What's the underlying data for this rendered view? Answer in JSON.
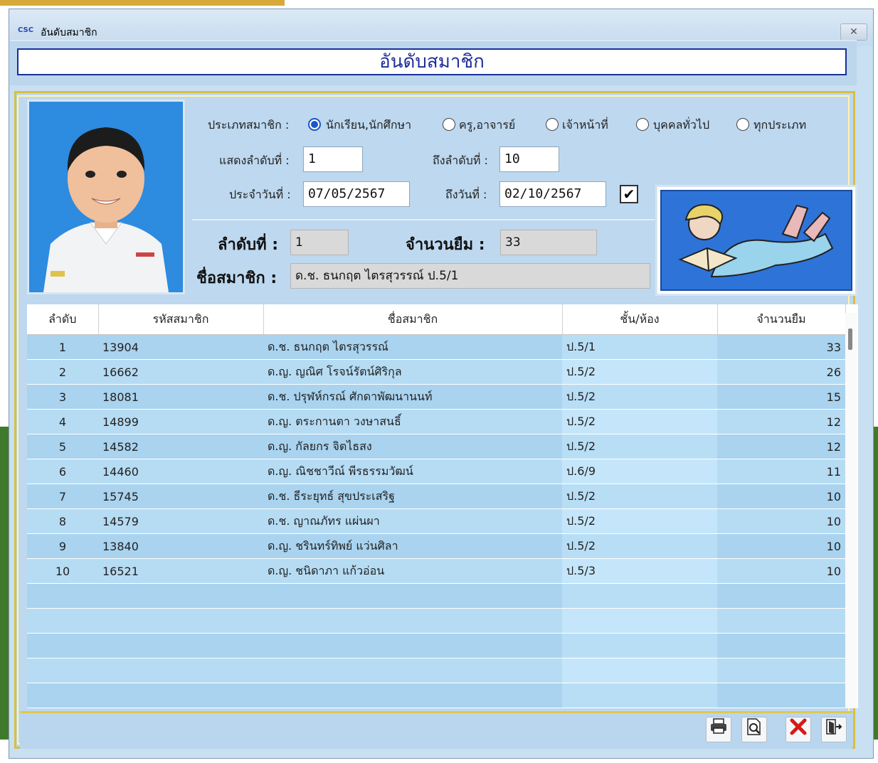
{
  "window": {
    "icon_text": "CSC",
    "title": "อันดับสมาชิก",
    "close_glyph": "✕"
  },
  "header": {
    "title": "อันดับสมาชิก"
  },
  "filters": {
    "member_type_label": "ประเภทสมาชิก :",
    "options": [
      {
        "label": "นักเรียน,นักศึกษา",
        "selected": true
      },
      {
        "label": "ครู,อาจารย์",
        "selected": false
      },
      {
        "label": "เจ้าหน้าที่",
        "selected": false
      },
      {
        "label": "บุคคลทั่วไป",
        "selected": false
      },
      {
        "label": "ทุกประเภท",
        "selected": false
      }
    ],
    "from_rank_label": "แสดงลำดับที่ :",
    "from_rank_value": "1",
    "to_rank_label": "ถึงลำดับที่ :",
    "to_rank_value": "10",
    "from_date_label": "ประจำวันที่ :",
    "from_date_value": "07/05/2567",
    "to_date_label": "ถึงวันที่ :",
    "to_date_value": "02/10/2567",
    "checkbox_checked": true,
    "checkbox_glyph": "✔"
  },
  "summary": {
    "rank_label": "ลำดับที่ :",
    "rank_value": "1",
    "borrow_label": "จำนวนยืม :",
    "borrow_value": "33",
    "member_label": "ชื่อสมาชิก :",
    "member_value": "ด.ช. ธนกฤต ไตรสุวรรณ์ ป.5/1"
  },
  "table": {
    "columns": [
      "ลำดับ",
      "รหัสสมาชิก",
      "ชื่อสมาชิก",
      "ชั้น/ห้อง",
      "จำนวนยืม"
    ],
    "rows": [
      [
        "1",
        "13904",
        "ด.ช. ธนกฤต ไตรสุวรรณ์",
        "ป.5/1",
        "33"
      ],
      [
        "2",
        "16662",
        "ด.ญ. ญณิศ โรจน์รัตน์ศิริกุล",
        "ป.5/2",
        "26"
      ],
      [
        "3",
        "18081",
        "ด.ช. ปรุฬห์กรณ์ ศักดาพัฒนานนท์",
        "ป.5/2",
        "15"
      ],
      [
        "4",
        "14899",
        "ด.ญ. ตระกานตา วงษาสนธิ์",
        "ป.5/2",
        "12"
      ],
      [
        "5",
        "14582",
        "ด.ญ. กัลยกร จิตไธสง",
        "ป.5/2",
        "12"
      ],
      [
        "6",
        "14460",
        "ด.ญ. ณิชชาวีณ์ พีรธรรมวัฒน์",
        "ป.6/9",
        "11"
      ],
      [
        "7",
        "15745",
        "ด.ช. ธีระยุทธ์ สุขประเสริฐ",
        "ป.5/2",
        "10"
      ],
      [
        "8",
        "14579",
        "ด.ช. ญาณภัทร แผ่นผา",
        "ป.5/2",
        "10"
      ],
      [
        "9",
        "13840",
        "ด.ญ. ชรินทร์ทิพย์ แว่นศิลา",
        "ป.5/2",
        "10"
      ],
      [
        "10",
        "16521",
        "ด.ญ. ชนิดาภา แก้วอ่อน",
        "ป.5/3",
        "10"
      ]
    ],
    "empty_rows": 5
  },
  "colors": {
    "window_bg": "#c9e0f2",
    "header_border": "#1a2f9a",
    "header_text": "#1f2d9a",
    "panel_border": "#d9bf3d",
    "grid_row": "#a9d3ef",
    "delete_red": "#d81818"
  },
  "toolbar": {
    "print_icon": "printer-icon",
    "preview_icon": "print-preview-icon",
    "delete_icon": "delete-x-icon",
    "exit_icon": "exit-door-icon"
  }
}
